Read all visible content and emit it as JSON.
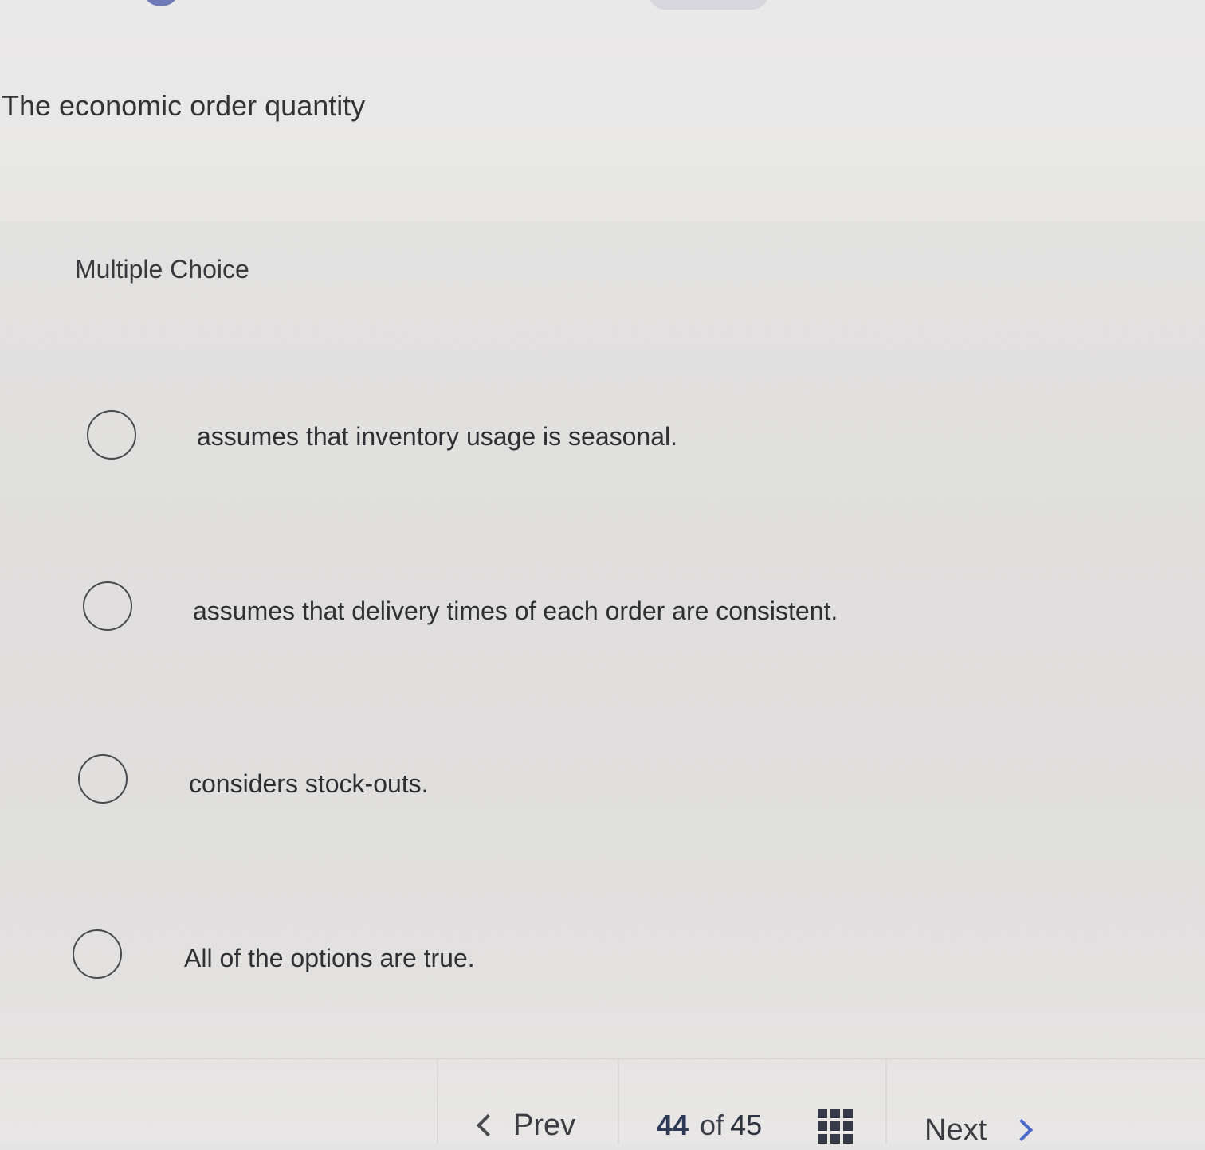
{
  "question": {
    "text": "The economic order quantity",
    "type_label": "Multiple Choice"
  },
  "options": [
    {
      "label": "assumes that inventory usage is seasonal.",
      "selected": false
    },
    {
      "label": "assumes that delivery times of each order are consistent.",
      "selected": false
    },
    {
      "label": "considers stock-outs.",
      "selected": false
    },
    {
      "label": "All of the options are true.",
      "selected": false
    }
  ],
  "navigation": {
    "prev_label": "Prev",
    "current_page": "44",
    "of_label": "of",
    "total_pages": "45",
    "next_label": "Next",
    "prev_icon": "chevron-left-icon",
    "next_icon": "chevron-right-icon",
    "grid_icon": "question-grid-icon"
  },
  "colors": {
    "background": "#e2e1e0",
    "text": "#2f2f33",
    "next_chevron": "#4a66c8",
    "page_number": "#2e3a55"
  }
}
